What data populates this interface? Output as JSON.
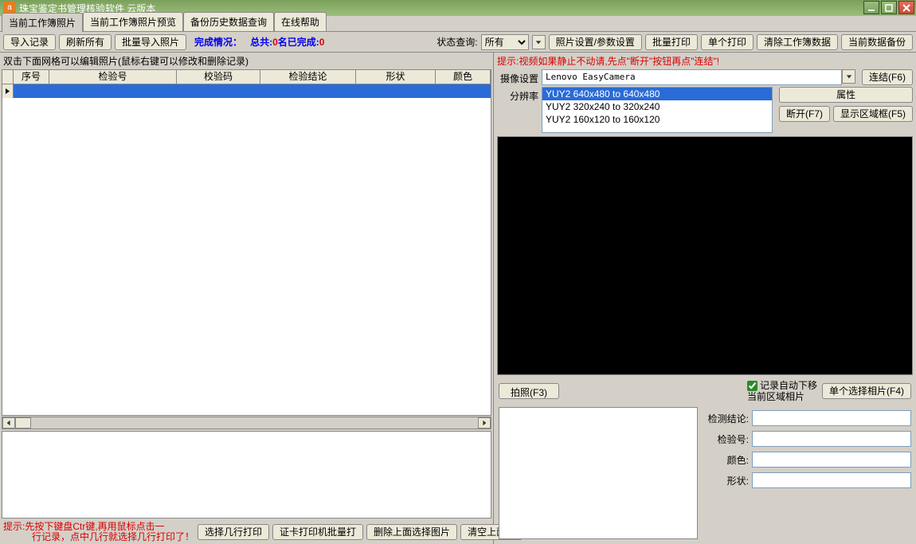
{
  "title": "珠宝鉴定书管理核验软件 云版本",
  "app_icon_char": "a",
  "tabs": [
    "当前工作簿照片",
    "当前工作簿照片预览",
    "备份历史数据查询",
    "在线帮助"
  ],
  "toolbar": {
    "import": "导入记录",
    "refresh": "刷新所有",
    "batch_import": "批量导入照片",
    "status_label": "完成情况：",
    "total_label": "总共:",
    "total": "0",
    "done_label": "名已完成:",
    "done": "0",
    "query_label": "状态查询:",
    "query_options": [
      "所有"
    ],
    "photo_settings": "照片设置/参数设置",
    "batch_print": "批量打印",
    "single_print": "单个打印",
    "clear_wb": "清除工作簿数据",
    "backup": "当前数据备份"
  },
  "grid_hint": "双击下面网格可以编辑照片(鼠标右键可以修改和删除记录)",
  "grid_headers": [
    "序号",
    "检验号",
    "校验码",
    "检验结论",
    "形状",
    "颜色"
  ],
  "bottom_hint": "提示:先按下键盘Ctr键,再用鼠标点击一\n　　　行记录，点中几行就选择几行打印了！",
  "bottom_buttons": [
    "选择几行打印",
    "证卡打印机批量打",
    "删除上面选择图片",
    "清空上面图"
  ],
  "right": {
    "hint": "提示:视频如果静止不动请,先点\"断开\"按钮再点\"连结\"!",
    "cam_label": "摄像设置",
    "cam_value": "Lenovo EasyCamera",
    "res_label": "分辨率",
    "res_options": [
      "YUY2 640x480 to 640x480",
      "YUY2 320x240 to 320x240",
      "YUY2 160x120 to 160x120"
    ],
    "connect": "连结(F6)",
    "props": "属性",
    "disconnect": "断开(F7)",
    "show_region": "显示区域框(F5)",
    "capture": "拍照(F3)",
    "auto_move": "记录自动下移",
    "current_region": "当前区域相片",
    "single_select": "单个选择相片(F4)",
    "fields": {
      "result": "检测结论:",
      "check_no": "检验号:",
      "color": "颜色:",
      "shape": "形状:"
    }
  }
}
